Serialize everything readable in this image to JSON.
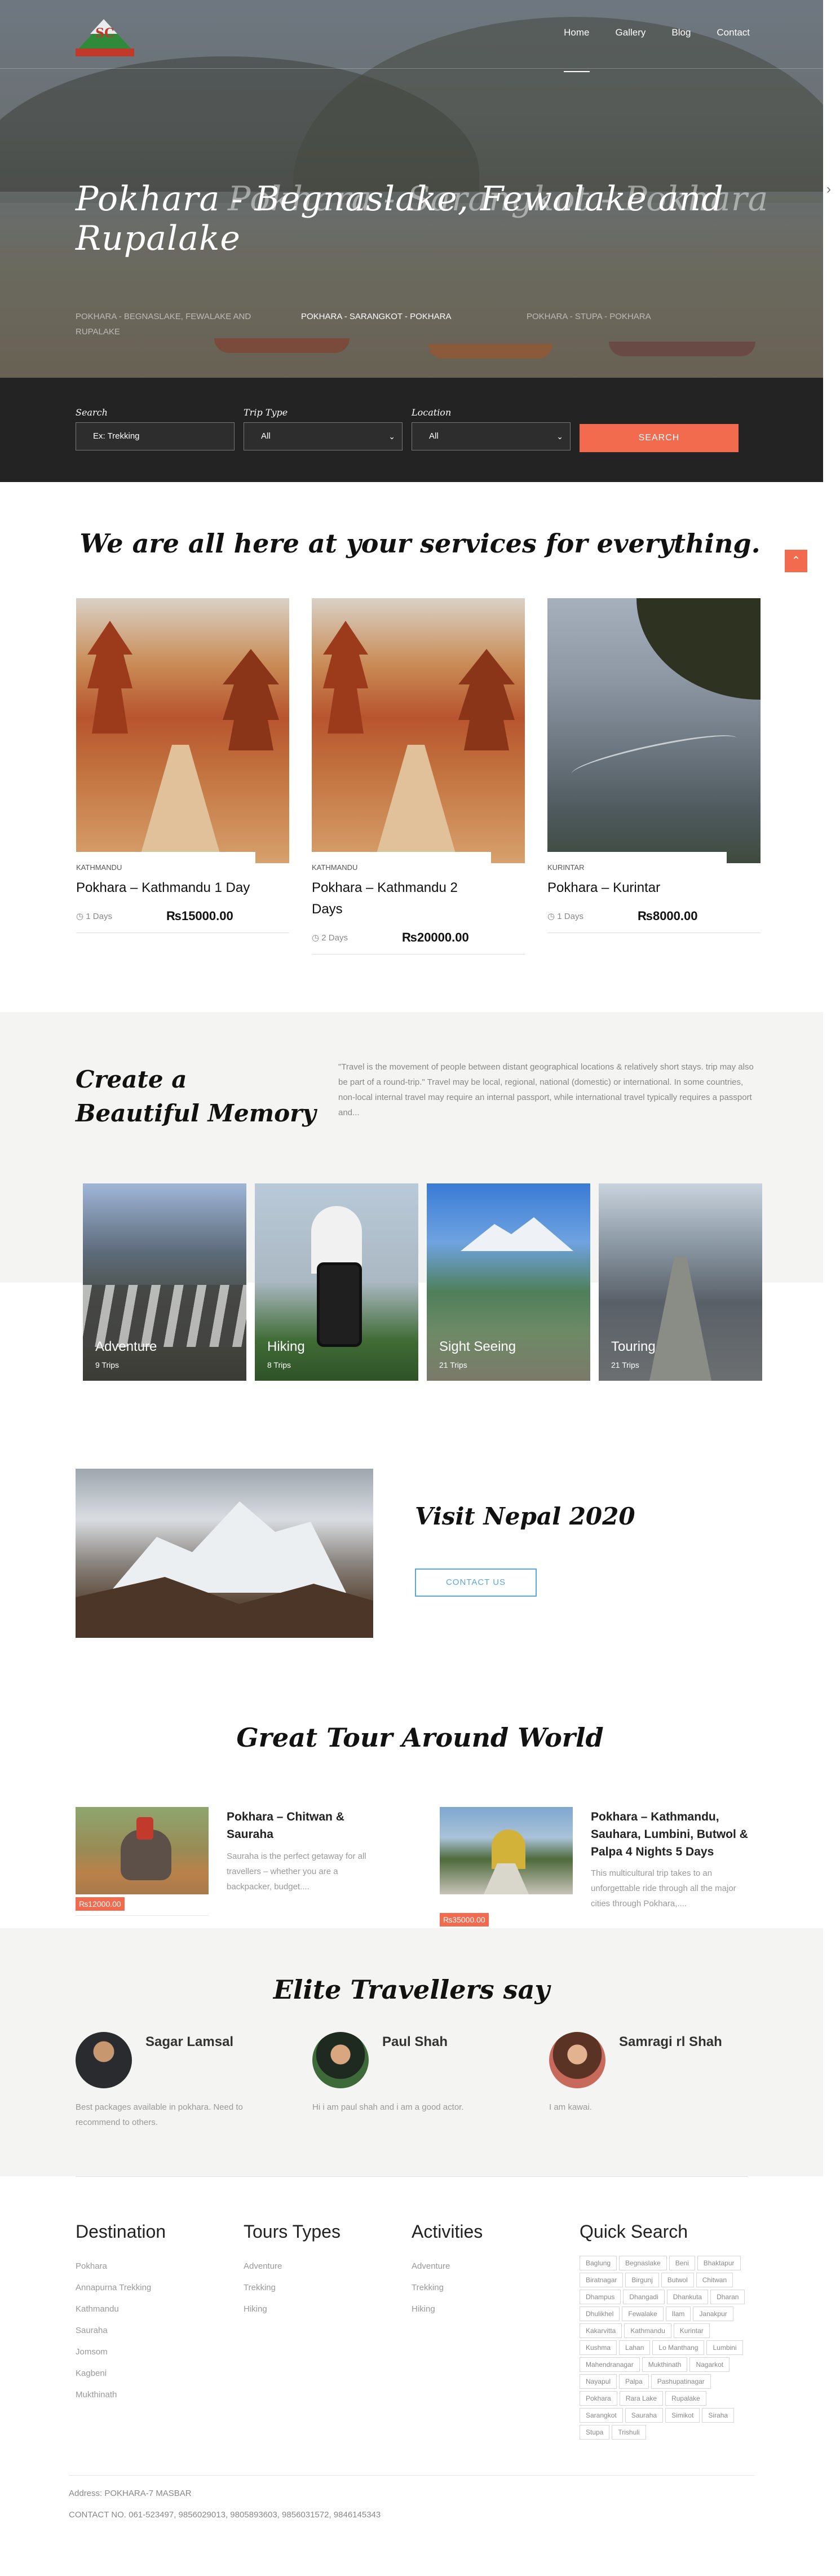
{
  "nav": {
    "items": [
      {
        "label": "Home"
      },
      {
        "label": "Gallery"
      },
      {
        "label": "Blog"
      },
      {
        "label": "Contact"
      }
    ]
  },
  "logo": {
    "text": "SC"
  },
  "hero": {
    "title": "Pokhara - Begnaslake, Fewalake and Rupalake",
    "ghost": "Pokhara - Sarangkot - Pokhara",
    "slides": [
      {
        "label": "POKHARA - BEGNASLAKE, FEWALAKE AND RUPALAKE"
      },
      {
        "label": "POKHARA - SARANGKOT - POKHARA"
      },
      {
        "label": "POKHARA - STUPA - POKHARA"
      }
    ],
    "next_icon": "chevron-right-icon"
  },
  "search": {
    "search_label": "Search",
    "search_placeholder": "Ex: Trekking",
    "trip_type_label": "Trip Type",
    "trip_type_value": "All",
    "location_label": "Location",
    "location_value": "All",
    "button": "SEARCH"
  },
  "services": {
    "heading": "We are all here at your services for everything.",
    "scroll_icon": "chevron-up-icon",
    "cards": [
      {
        "location": "KATHMANDU",
        "title": "Pokhara – Kathmandu 1 Day",
        "days": "1 Days",
        "price": "₨15000.00"
      },
      {
        "location": "KATHMANDU",
        "title": "Pokhara – Kathmandu 2 Days",
        "days": "2 Days",
        "price": "₨20000.00"
      },
      {
        "location": "KURINTAR",
        "title": "Pokhara – Kurintar",
        "days": "1 Days",
        "price": "₨8000.00"
      }
    ]
  },
  "memory": {
    "heading_line1": "Create a",
    "heading_line2": "Beautiful Memory",
    "quote": "\"Travel is the movement of people between distant geographical locations & relatively short stays. trip may also be part of a round-trip.\" Travel may be local, regional, national (domestic) or international. In some countries, non-local internal travel may require an internal passport, while international travel typically requires a passport and...",
    "tiles": [
      {
        "name": "Adventure",
        "count": "9 Trips"
      },
      {
        "name": "Hiking",
        "count": "8 Trips"
      },
      {
        "name": "Sight Seeing",
        "count": "21 Trips"
      },
      {
        "name": "Touring",
        "count": "21 Trips"
      }
    ]
  },
  "visit": {
    "heading": "Visit Nepal 2020",
    "button": "CONTACT US"
  },
  "great": {
    "heading": "Great Tour Around World",
    "tours": [
      {
        "title": "Pokhara – Chitwan & Sauraha",
        "desc": "Sauraha is the perfect getaway for all travellers – whether you are a backpacker, budget....",
        "price": "₨12000.00"
      },
      {
        "title": "Pokhara – Kathmandu, Sauhara, Lumbini, Butwol & Palpa 4 Nights 5 Days",
        "desc": "This multicultural trip takes to an unforgettable ride through all the major cities through Pokhara,....",
        "price": "₨35000.00"
      }
    ]
  },
  "elite": {
    "heading": "Elite Travellers say",
    "items": [
      {
        "name": "Sagar Lamsal",
        "text": "Best packages available in pokhara. Need to recommend to others."
      },
      {
        "name": "Paul Shah",
        "text": "Hi i am paul shah and i am a good actor."
      },
      {
        "name": "Samragi rl Shah",
        "text": "I am kawai."
      }
    ]
  },
  "footer": {
    "destination": {
      "heading": "Destination",
      "items": [
        "Pokhara",
        "Annapurna Trekking",
        "Kathmandu",
        "Sauraha",
        "Jomsom",
        "Kagbeni",
        "Mukthinath"
      ]
    },
    "tours_types": {
      "heading": "Tours Types",
      "items": [
        "Adventure",
        "Trekking",
        "Hiking"
      ]
    },
    "activities": {
      "heading": "Activities",
      "items": [
        "Adventure",
        "Trekking",
        "Hiking"
      ]
    },
    "quick_search": {
      "heading": "Quick Search",
      "tags": [
        "Baglung",
        "Begnaslake",
        "Beni",
        "Bhaktapur",
        "Biratnagar",
        "Birgunj",
        "Butwol",
        "Chitwan",
        "Dhampus",
        "Dhangadi",
        "Dhankuta",
        "Dharan",
        "Dhulikhel",
        "Fewalake",
        "Ilam",
        "Janakpur",
        "Kakarvitta",
        "Kathmandu",
        "Kurintar",
        "Kushma",
        "Lahan",
        "Lo Manthang",
        "Lumbini",
        "Mahendranagar",
        "Mukthinath",
        "Nagarkot",
        "Nayapul",
        "Palpa",
        "Pashupatinagar",
        "Pokhara",
        "Rara Lake",
        "Rupalake",
        "Sarangkot",
        "Sauraha",
        "Simikot",
        "Siraha",
        "Stupa",
        "Trishuli"
      ]
    },
    "address": "Address: POKHARA-7 MASBAR",
    "contact": "CONTACT NO. 061-523497, 9856029013, 9805893603, 9856031572, 9846145343"
  }
}
